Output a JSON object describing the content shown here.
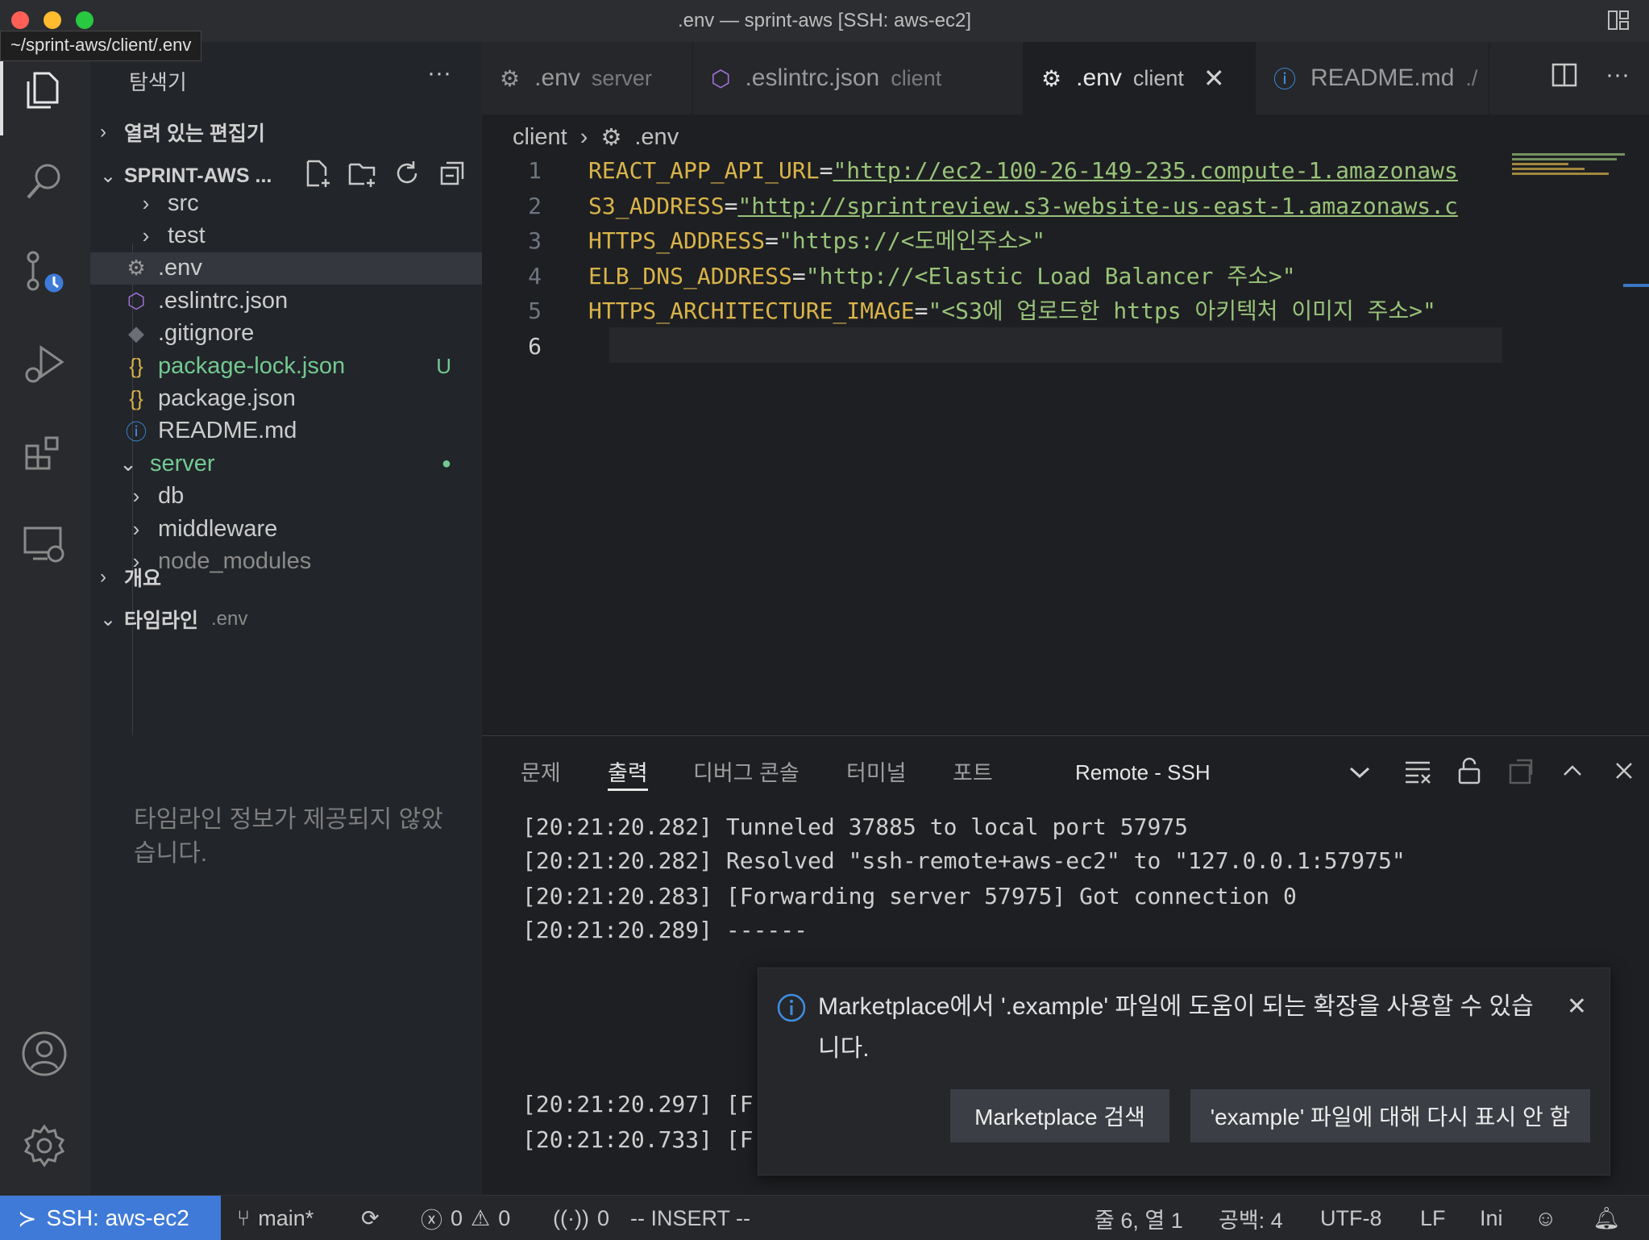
{
  "window": {
    "title": ".env — sprint-aws [SSH: aws-ec2]",
    "path_tooltip": "~/sprint-aws/client/.env"
  },
  "sidebar": {
    "title": "탐색기",
    "open_editors": "열려 있는 편집기",
    "workspace": "SPRINT-AWS ...",
    "tree": [
      {
        "label": "src",
        "type": "folder-collapsed"
      },
      {
        "label": "test",
        "type": "folder-collapsed"
      },
      {
        "label": ".env",
        "type": "file",
        "icon": "gear-icon",
        "selected": true
      },
      {
        "label": ".eslintrc.json",
        "type": "file",
        "icon": "eslint-icon"
      },
      {
        "label": ".gitignore",
        "type": "file",
        "icon": "git-icon"
      },
      {
        "label": "package-lock.json",
        "type": "file",
        "icon": "json-icon",
        "badge": "U",
        "color": "#73c991"
      },
      {
        "label": "package.json",
        "type": "file",
        "icon": "json-icon"
      },
      {
        "label": "README.md",
        "type": "file",
        "icon": "info-icon"
      },
      {
        "label": "server",
        "type": "folder-expanded",
        "color": "#73c991"
      },
      {
        "label": "db",
        "type": "folder-collapsed"
      },
      {
        "label": "middleware",
        "type": "folder-collapsed"
      },
      {
        "label": "node_modules",
        "type": "folder-collapsed",
        "color": "#8a8a8a"
      }
    ],
    "outline": "개요",
    "timeline": "타임라인",
    "timeline_file": ".env",
    "timeline_message": "타임라인 정보가 제공되지 않았습니다."
  },
  "tabs": [
    {
      "name": ".env",
      "desc": "server",
      "icon": "gear-icon",
      "active": false
    },
    {
      "name": ".eslintrc.json",
      "desc": "client",
      "icon": "eslint-icon",
      "active": false
    },
    {
      "name": ".env",
      "desc": "client",
      "icon": "gear-icon",
      "active": true
    },
    {
      "name": "README.md",
      "desc": "./",
      "icon": "info-icon",
      "active": false
    }
  ],
  "breadcrumb": {
    "folder": "client",
    "file": ".env"
  },
  "code": [
    {
      "n": "1",
      "key": "REACT_APP_API_URL",
      "value": "\"http://ec2-100-26-149-235.compute-1.amazonaws",
      "url": true
    },
    {
      "n": "2",
      "key": "S3_ADDRESS",
      "value": "\"http://sprintreview.s3-website-us-east-1.amazonaws.c",
      "url": true
    },
    {
      "n": "3",
      "key": "HTTPS_ADDRESS",
      "value": "\"https://<도메인주소>\"",
      "url": false
    },
    {
      "n": "4",
      "key": "ELB_DNS_ADDRESS",
      "value": "\"http://<Elastic Load Balancer 주소>\"",
      "url": false
    },
    {
      "n": "5",
      "key": "HTTPS_ARCHITECTURE_IMAGE",
      "value": "\"<S3에 업로드한 https 아키텍처 이미지 주소>\"",
      "url": false
    },
    {
      "n": "6",
      "key": "",
      "value": "",
      "url": false,
      "current": true
    }
  ],
  "panel": {
    "tabs": [
      "문제",
      "출력",
      "디버그 콘솔",
      "터미널",
      "포트"
    ],
    "active_tab": "출력",
    "output_channel": "Remote - SSH",
    "log": [
      "[20:21:20.282] Tunneled 37885 to local port 57975",
      "[20:21:20.282] Resolved \"ssh-remote+aws-ec2\" to \"127.0.0.1:57975\"",
      "[20:21:20.283] [Forwarding server 57975] Got connection 0",
      "[20:21:20.289] ------",
      "[20:21:20.297] [F",
      "[20:21:20.733] [F"
    ]
  },
  "notification": {
    "message": "Marketplace에서 '.example' 파일에 도움이 되는 확장을 사용할 수 있습니다.",
    "button_search": "Marketplace 검색",
    "button_dismiss": "'example' 파일에 대해 다시 표시 안 함"
  },
  "statusbar": {
    "remote": "SSH: aws-ec2",
    "branch": "main*",
    "errors": "0",
    "warnings": "0",
    "ports": "0",
    "mode": "-- INSERT --",
    "position": "줄 6, 열 1",
    "spaces": "공백: 4",
    "encoding": "UTF-8",
    "eol": "LF",
    "language": "Ini"
  },
  "colors": {
    "accent": "#3f7ad8",
    "key": "#d9b44a",
    "string": "#98c379",
    "git_untracked": "#73c991"
  }
}
